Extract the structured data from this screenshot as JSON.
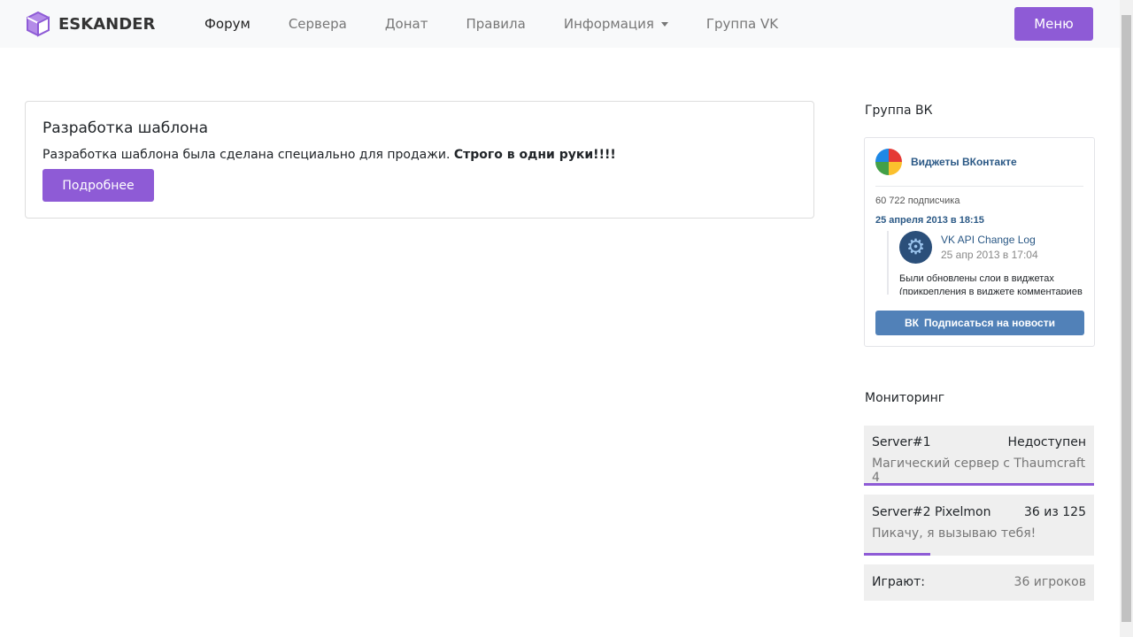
{
  "brand": {
    "name": "ESKANDER",
    "color": "#8e5bd6"
  },
  "nav": {
    "items": [
      "Форум",
      "Сервера",
      "Донат",
      "Правила",
      "Информация",
      "Группа VK"
    ],
    "menu": "Меню"
  },
  "card": {
    "title": "Разработка шаблона",
    "text": "Разработка шаблона была сделана специально для продажи. ",
    "bold": "Строго в одни руки!!!!",
    "button": "Подробнее"
  },
  "vk_section": {
    "title": "Группа ВК",
    "group": "Виджеты ВКонтакте",
    "subscribers": "60 722 подписчика",
    "date": "25 апреля 2013 в 18:15",
    "post_author": "VK API Change Log",
    "post_time": "25 апр 2013 в 17:04",
    "post_text": "Были обновлены слои в виджетах (прикрепления в виджете комментариев",
    "subscribe": "Подписаться на новости"
  },
  "monitoring": {
    "title": "Мониторинг",
    "servers": [
      {
        "name": "Server#1",
        "status": "Недоступен",
        "desc": "Магический сервер с Thaumcraft 4",
        "fill_percent": 100
      },
      {
        "name": "Server#2 Pixelmon",
        "status": "36 из 125",
        "desc": "Пикачу, я вызываю тебя!",
        "fill_percent": 29
      }
    ],
    "total_label": "Играют:",
    "total_value": "36 игроков"
  }
}
